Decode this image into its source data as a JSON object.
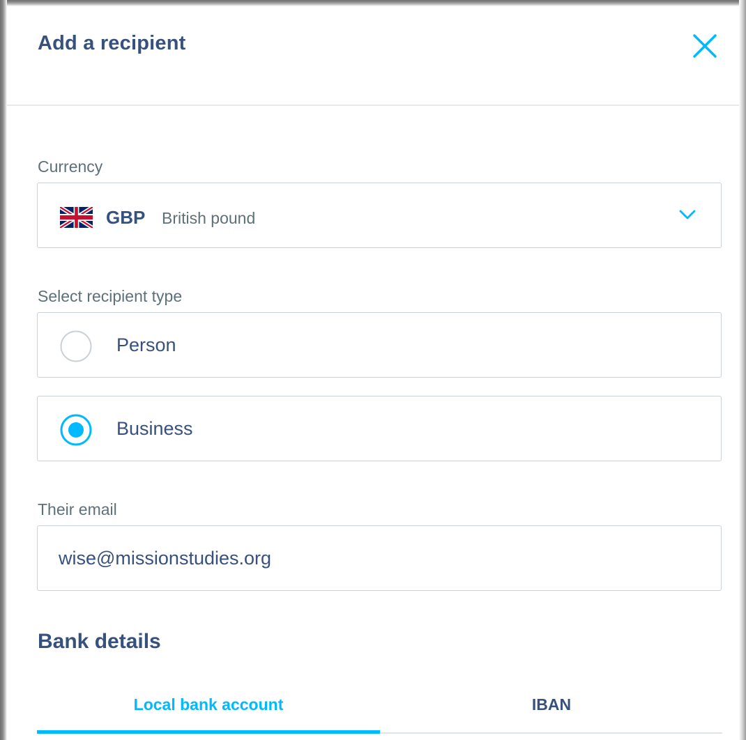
{
  "dialog": {
    "title": "Add a recipient",
    "close_icon": "close-icon"
  },
  "currency": {
    "label": "Currency",
    "flag_icon": "uk-flag-icon",
    "code": "GBP",
    "name": "British pound",
    "dropdown_icon": "chevron-down-icon"
  },
  "recipient_type": {
    "label": "Select recipient type",
    "options": [
      {
        "label": "Person",
        "selected": false
      },
      {
        "label": "Business",
        "selected": true
      }
    ]
  },
  "email": {
    "label": "Their email",
    "value": "wise@missionstudies.org"
  },
  "bank_details": {
    "title": "Bank details",
    "tabs": [
      {
        "label": "Local bank account",
        "active": true
      },
      {
        "label": "IBAN",
        "active": false
      }
    ]
  },
  "colors": {
    "accent": "#00b9ff",
    "heading": "#37517e",
    "label": "#5d7079",
    "border": "#c9d0d6"
  }
}
